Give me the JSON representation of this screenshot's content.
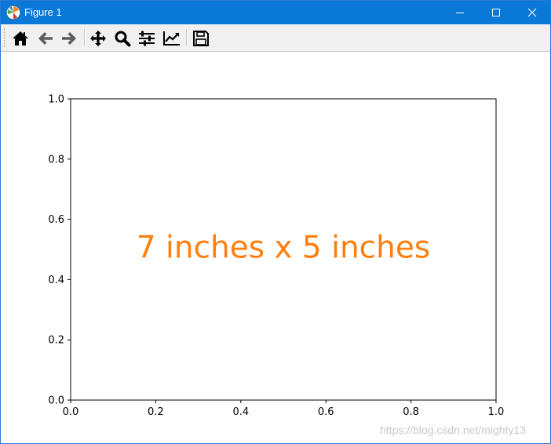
{
  "window": {
    "title": "Figure 1"
  },
  "titlebar_icons": {
    "minimize": "minimize-icon",
    "maximize": "maximize-icon",
    "close": "close-icon"
  },
  "toolbar": {
    "items": [
      {
        "name": "home-icon",
        "tooltip": ""
      },
      {
        "name": "back-icon",
        "tooltip": ""
      },
      {
        "name": "forward-icon",
        "tooltip": ""
      },
      {
        "name": "pan-icon",
        "tooltip": ""
      },
      {
        "name": "zoom-icon",
        "tooltip": ""
      },
      {
        "name": "subplots-icon",
        "tooltip": ""
      },
      {
        "name": "customize-icon",
        "tooltip": ""
      },
      {
        "name": "save-icon",
        "tooltip": ""
      }
    ]
  },
  "chart_data": {
    "type": "line",
    "title": "",
    "xlabel": "",
    "ylabel": "",
    "xlim": [
      0.0,
      1.0
    ],
    "ylim": [
      0.0,
      1.0
    ],
    "xticks": [
      "0.0",
      "0.2",
      "0.4",
      "0.6",
      "0.8",
      "1.0"
    ],
    "yticks": [
      "0.0",
      "0.2",
      "0.4",
      "0.6",
      "0.8",
      "1.0"
    ],
    "grid": false,
    "series": [],
    "annotation": {
      "text": "7 inches x 5 inches",
      "x": 0.5,
      "y": 0.5,
      "color": "#ff7f0e"
    }
  },
  "watermark": "https://blog.csdn.net/mighty13",
  "colors": {
    "titlebar": "#0a78d7",
    "annotation": "#ff7f0e",
    "axes": "#000000"
  }
}
